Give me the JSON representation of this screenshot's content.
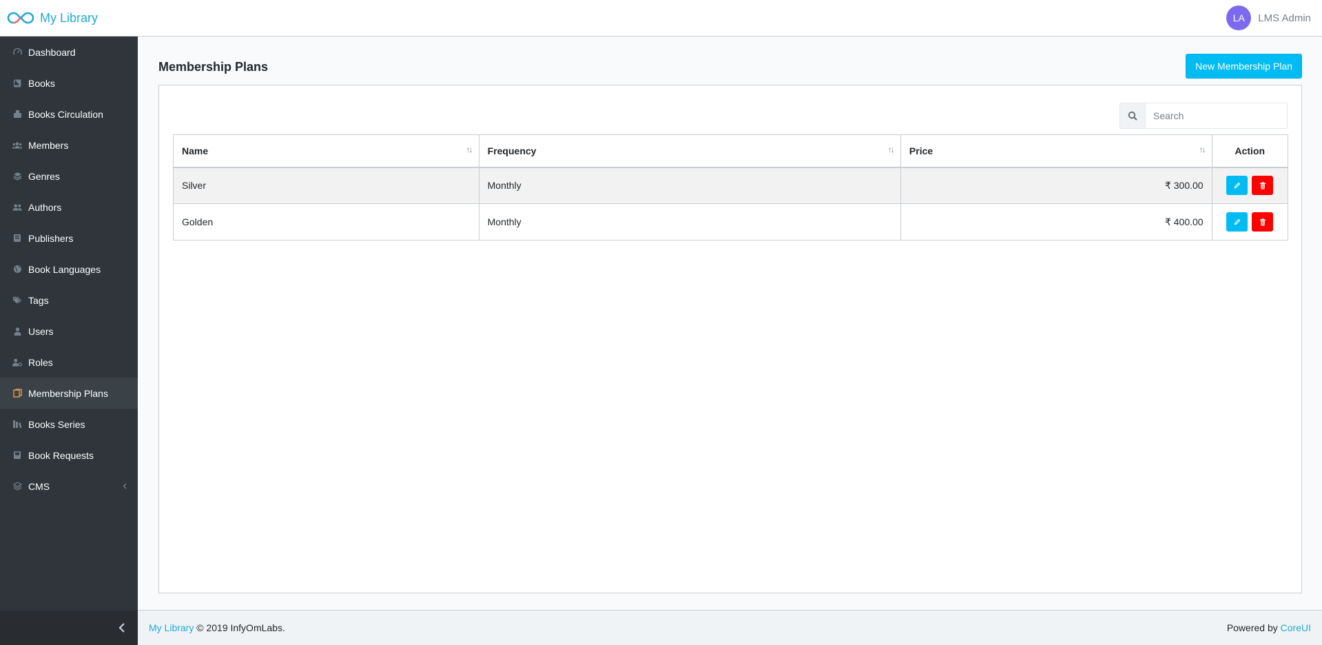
{
  "header": {
    "brand": "My Library",
    "avatar_initials": "LA",
    "user_name": "LMS Admin"
  },
  "sidebar": {
    "items": [
      {
        "label": "Dashboard",
        "icon": "speedometer-icon"
      },
      {
        "label": "Books",
        "icon": "book-icon"
      },
      {
        "label": "Books Circulation",
        "icon": "books-circulation-icon"
      },
      {
        "label": "Members",
        "icon": "members-icon"
      },
      {
        "label": "Genres",
        "icon": "layers-icon"
      },
      {
        "label": "Authors",
        "icon": "authors-icon"
      },
      {
        "label": "Publishers",
        "icon": "publisher-icon"
      },
      {
        "label": "Book Languages",
        "icon": "globe-icon"
      },
      {
        "label": "Tags",
        "icon": "tags-icon"
      },
      {
        "label": "Users",
        "icon": "user-icon"
      },
      {
        "label": "Roles",
        "icon": "user-cog-icon"
      },
      {
        "label": "Membership Plans",
        "icon": "membership-icon",
        "active": true
      },
      {
        "label": "Books Series",
        "icon": "series-icon"
      },
      {
        "label": "Book Requests",
        "icon": "book-request-icon"
      },
      {
        "label": "CMS",
        "icon": "layers-icon"
      }
    ]
  },
  "page": {
    "title": "Membership Plans",
    "new_button": "New Membership Plan",
    "search_placeholder": "Search"
  },
  "table": {
    "columns": [
      "Name",
      "Frequency",
      "Price",
      "Action"
    ],
    "rows": [
      {
        "name": "Silver",
        "frequency": "Monthly",
        "price": "₹ 300.00"
      },
      {
        "name": "Golden",
        "frequency": "Monthly",
        "price": "₹ 400.00"
      }
    ]
  },
  "footer": {
    "brand_link": "My Library",
    "copyright": "© 2019 InfyOmLabs.",
    "powered_by": "Powered by",
    "powered_link": "CoreUI"
  },
  "colors": {
    "accent": "#20a8d8",
    "sidebar_bg": "#2f353a",
    "primary_button": "#00bcf2",
    "danger_button": "#ff0000",
    "avatar_bg": "#7c69ef"
  }
}
